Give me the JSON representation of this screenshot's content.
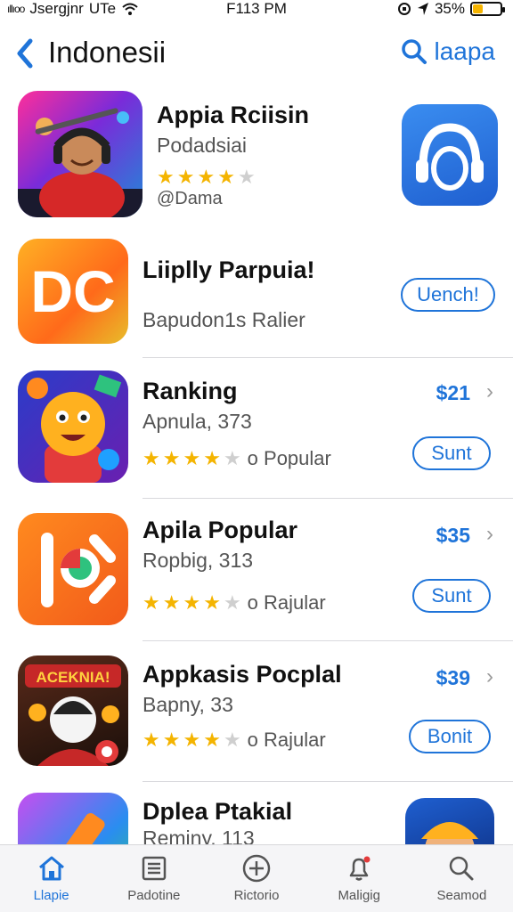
{
  "status_bar": {
    "signal": "ıllıoo",
    "carrier": "Jsergjnr",
    "network": "UTe",
    "time": "F113 PM",
    "battery": "35%",
    "battery_level": 0.35
  },
  "header": {
    "back_icon": "chevron-left-icon",
    "title": "Indonesii",
    "search_label": "laapa",
    "search_icon": "search-icon"
  },
  "apps": [
    {
      "title": "Appia Rciisin",
      "subtitle": "Podadsiai",
      "rating": 4,
      "stars_text": "",
      "developer": "@Dama",
      "price": "",
      "action": ""
    },
    {
      "title": "Liiplly Parpuia!",
      "subtitle": "Bapudon1s Ralier",
      "rating": 0,
      "stars_text": "",
      "developer": "",
      "price": "",
      "action": "Uench!"
    },
    {
      "title": "Ranking",
      "subtitle": "Apnula, 373",
      "rating": 4,
      "stars_text": "o Popular",
      "developer": "",
      "price": "$21",
      "action": "Sunt"
    },
    {
      "title": "Apila Popular",
      "subtitle": "Ropbig, 313",
      "rating": 4,
      "stars_text": "o Rajular",
      "developer": "",
      "price": "$35",
      "action": "Sunt"
    },
    {
      "title": "Appkasis Pocplal",
      "subtitle": "Bapny, 33",
      "rating": 4,
      "stars_text": "o Rajular",
      "developer": "",
      "price": "$39",
      "action": "Bonit"
    },
    {
      "title": "Dplea Ptakial",
      "subtitle": "Reminy, 113",
      "rating": 0,
      "stars_text": "",
      "developer": "",
      "price": "",
      "action": ""
    }
  ],
  "icon_art": {
    "banner_text": "ACEKNIA!"
  },
  "tabbar": [
    {
      "label": "Llapie",
      "icon": "home-icon",
      "active": true
    },
    {
      "label": "Padotine",
      "icon": "list-icon",
      "active": false
    },
    {
      "label": "Rictorio",
      "icon": "plus-circle-icon",
      "active": false
    },
    {
      "label": "Maligig",
      "icon": "bell-icon",
      "active": false
    },
    {
      "label": "Seamod",
      "icon": "search-icon",
      "active": false
    }
  ],
  "colors": {
    "accent": "#1f74d9",
    "star": "#f4b400",
    "divider": "#d9d9dd"
  }
}
